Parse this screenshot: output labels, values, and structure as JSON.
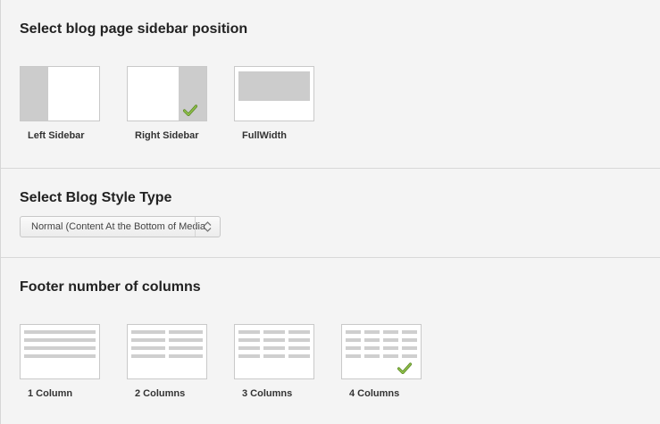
{
  "sidebar_section": {
    "title": "Select blog page sidebar position",
    "options": [
      {
        "label": "Left Sidebar",
        "icon": "left-sidebar-layout-icon",
        "selected": false
      },
      {
        "label": "Right Sidebar",
        "icon": "right-sidebar-layout-icon",
        "selected": true
      },
      {
        "label": "FullWidth",
        "icon": "fullwidth-layout-icon",
        "selected": false
      }
    ]
  },
  "style_section": {
    "title": "Select Blog Style Type",
    "select_value": "Normal (Content At the Bottom of Media)"
  },
  "footer_section": {
    "title": "Footer number of columns",
    "options": [
      {
        "label": "1 Column",
        "icon": "one-column-layout-icon",
        "selected": false
      },
      {
        "label": "2 Columns",
        "icon": "two-columns-layout-icon",
        "selected": false
      },
      {
        "label": "3 Columns",
        "icon": "three-columns-layout-icon",
        "selected": false
      },
      {
        "label": "4 Columns",
        "icon": "four-columns-layout-icon",
        "selected": true
      }
    ]
  },
  "colors": {
    "background": "#f4f4f4",
    "thumb_fill": "#cccccc",
    "check_green": "#7aa83a"
  }
}
